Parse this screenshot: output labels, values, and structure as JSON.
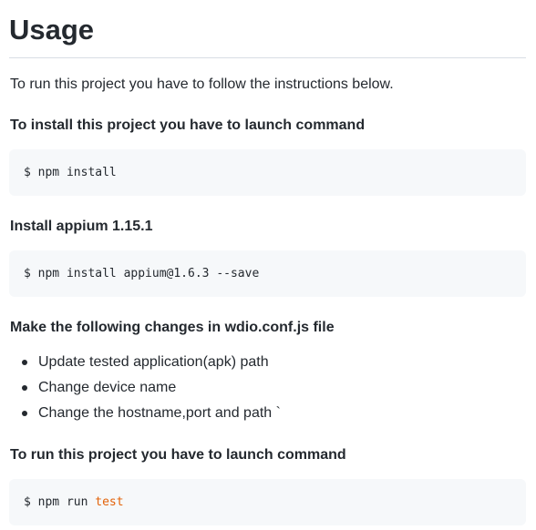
{
  "heading": "Usage",
  "intro": "To run this project you have to follow the instructions below.",
  "sections": [
    {
      "title": "To install this project you have to launch command",
      "code": "$ npm install"
    },
    {
      "title": "Install appium 1.15.1",
      "code": "$ npm install appium@1.6.3 --save"
    },
    {
      "title": "Make the following changes in wdio.conf.js file",
      "items": [
        "Update tested application(apk) path",
        "Change device name",
        "Change the hostname,port and path `"
      ]
    },
    {
      "title": "To run this project you have to launch command",
      "code_prefix": "$ npm run ",
      "code_keyword": "test"
    }
  ],
  "colors": {
    "text": "#24292f",
    "code_background": "#f6f8fa",
    "rule": "#d8dee4",
    "keyword": "#e36209"
  }
}
